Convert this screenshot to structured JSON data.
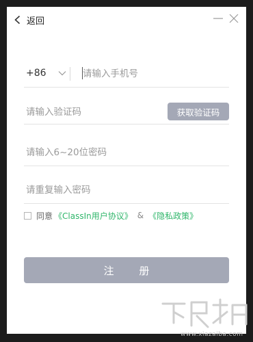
{
  "header": {
    "back_label": "返回",
    "back_icon": "chevron-left-icon",
    "minimize_icon": "minimize-icon",
    "close_icon": "close-icon"
  },
  "form": {
    "country_code": "+86",
    "phone_placeholder": "请输入手机号",
    "code_placeholder": "请输入验证码",
    "get_code_label": "获取验证码",
    "password_placeholder": "请输入6~20位密码",
    "confirm_placeholder": "请重复输入密码"
  },
  "agreement": {
    "prefix": "同意",
    "user_agreement": "《ClassIn用户协议》",
    "separator": "&",
    "privacy_policy": "《隐私政策》"
  },
  "submit": {
    "label": "注 册"
  },
  "watermark": {
    "url": "www.xiazaiba.com"
  },
  "colors": {
    "accent_green": "#2fb66a",
    "button_disabled": "#a4a8b6",
    "outer_background": "#1c1c1c"
  }
}
